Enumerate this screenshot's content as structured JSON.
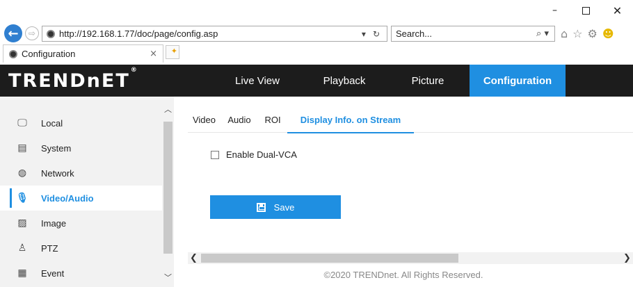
{
  "browser": {
    "window_controls": {
      "minimize": "–",
      "maximize": "",
      "close": "✕"
    },
    "back_symbol": "←",
    "forward_symbol": "⇨",
    "url": "http://192.168.1.77/doc/page/config.asp",
    "url_actions": {
      "dropdown": "▾",
      "refresh": "↻"
    },
    "search_placeholder": "Search...",
    "search_glyph": "⌕ ▾",
    "toolbar_icons": {
      "home": "⌂",
      "favorites": "☆",
      "settings": "⚙",
      "feedback": "☻"
    },
    "tab": {
      "title": "Configuration",
      "close": "×"
    },
    "new_tab_glyph": "✦"
  },
  "header": {
    "logo": "TRENDnET",
    "logo_mark": "®",
    "nav": [
      {
        "label": "Live View"
      },
      {
        "label": "Playback"
      },
      {
        "label": "Picture"
      },
      {
        "label": "Configuration",
        "active": true
      }
    ]
  },
  "sidebar": {
    "items": [
      {
        "label": "Local",
        "icon": "monitor-icon",
        "glyph": "🖵"
      },
      {
        "label": "System",
        "icon": "system-icon",
        "glyph": "▤"
      },
      {
        "label": "Network",
        "icon": "globe-icon",
        "glyph": "◍"
      },
      {
        "label": "Video/Audio",
        "icon": "video-audio-icon",
        "glyph": "🎙",
        "active": true
      },
      {
        "label": "Image",
        "icon": "image-icon",
        "glyph": "▨"
      },
      {
        "label": "PTZ",
        "icon": "ptz-icon",
        "glyph": "♙"
      },
      {
        "label": "Event",
        "icon": "calendar-icon",
        "glyph": "▦"
      }
    ],
    "scroll_up": "︿",
    "scroll_down": "﹀"
  },
  "content": {
    "tabs": [
      {
        "label": "Video"
      },
      {
        "label": "Audio"
      },
      {
        "label": "ROI"
      },
      {
        "label": "Display Info. on Stream",
        "active": true
      }
    ],
    "checkbox_label": "Enable Dual-VCA",
    "checkbox_checked": false,
    "save_label": "Save",
    "scroll_left": "❮",
    "scroll_right": "❯"
  },
  "footer": {
    "copyright": "©2020 TRENDnet. All Rights Reserved."
  },
  "colors": {
    "accent": "#1f8fe1",
    "header_bg": "#1c1c1c",
    "sidebar_bg": "#f2f2f2"
  }
}
